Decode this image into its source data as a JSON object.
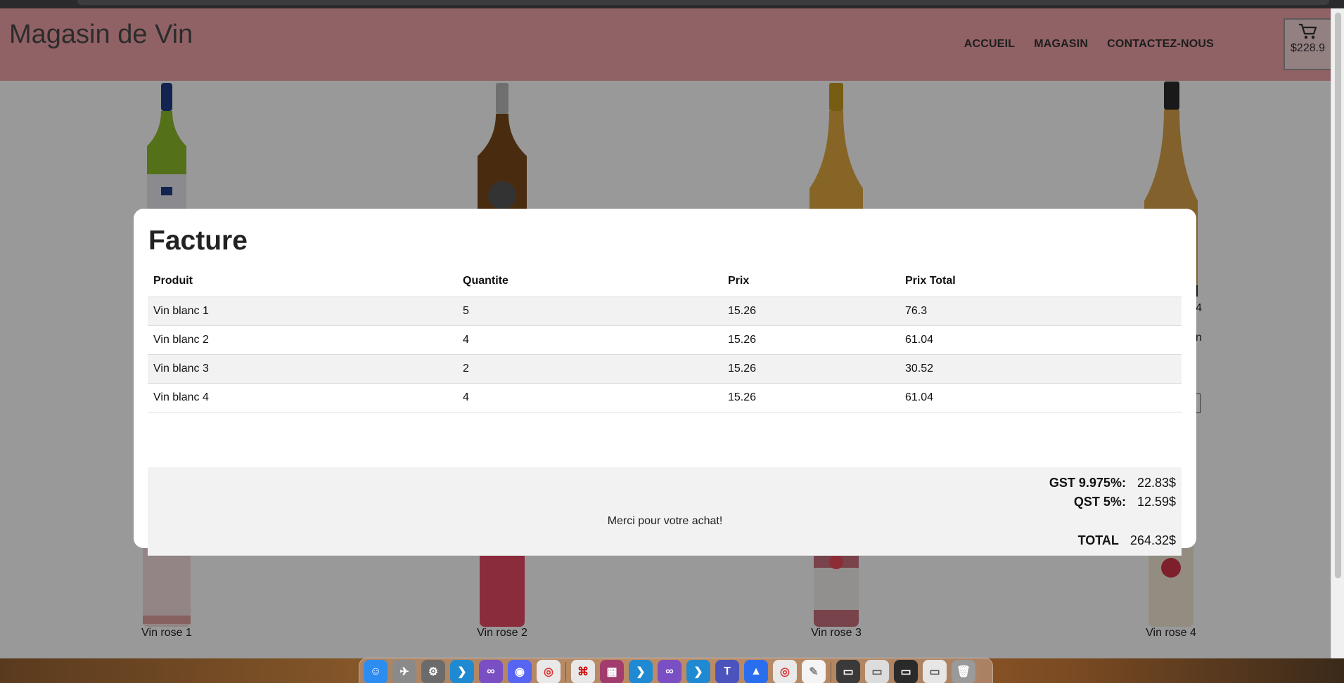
{
  "site": {
    "brand": "Magasin de Vin",
    "nav": [
      "ACCUEIL",
      "MAGASIN",
      "CONTACTEZ-NOUS"
    ],
    "cart_total": "$228.9"
  },
  "products_bottom": [
    "Vin rose 1",
    "Vin rose 2",
    "Vin rose 3",
    "Vin rose 4"
  ],
  "partial_labels": {
    "right_a": "4",
    "right_b": "n"
  },
  "invoice": {
    "title": "Facture",
    "headers": [
      "Produit",
      "Quantite",
      "Prix",
      "Prix Total"
    ],
    "rows": [
      [
        "Vin blanc 1",
        "5",
        "15.26",
        "76.3"
      ],
      [
        "Vin blanc 2",
        "4",
        "15.26",
        "61.04"
      ],
      [
        "Vin blanc 3",
        "2",
        "15.26",
        "30.52"
      ],
      [
        "Vin blanc 4",
        "4",
        "15.26",
        "61.04"
      ]
    ],
    "gst_label": "GST 9.975%:",
    "gst_value": "22.83$",
    "qst_label": "QST 5%:",
    "qst_value": "12.59$",
    "total_label": "TOTAL",
    "total_value": "264.32$",
    "thanks": "Merci pour votre achat!"
  },
  "colors": {
    "header_bg": "#f2a3a8",
    "overlay": "rgba(0,0,0,0.4)",
    "stripe": "#f2f2f2"
  },
  "dock_icons": [
    "finder-icon",
    "launchpad-icon",
    "settings-icon",
    "vscode-icon",
    "visual-studio-icon",
    "discord-icon",
    "chrome-icon",
    "acrobat-icon",
    "rar-icon",
    "vscode-icon",
    "visual-studio-icon",
    "vscode-icon",
    "teams-icon",
    "nordvpn-icon",
    "chrome-icon",
    "textedit-icon",
    "window-icon",
    "window-icon",
    "window-icon",
    "window-icon",
    "trash-icon"
  ]
}
